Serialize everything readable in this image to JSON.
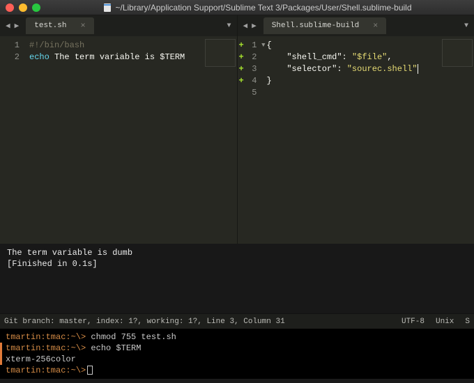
{
  "title": "~/Library/Application Support/Sublime Text 3/Packages/User/Shell.sublime-build",
  "left_tab": "test.sh",
  "right_tab": "Shell.sublime-build",
  "left_code": {
    "l1_shebang": "#!/bin/bash",
    "l2_kw": "echo",
    "l2_txt": " The term variable is $TERM"
  },
  "right_code": {
    "brace_open": "{",
    "k1": "\"shell_cmd\"",
    "v1": "\"$file\"",
    "k2": "\"selector\"",
    "v2": "\"sourec.shell\"",
    "brace_close": "}"
  },
  "build": {
    "line1": "The term variable is dumb",
    "line2": "[Finished in 0.1s]"
  },
  "status": {
    "left": "Git branch: master, index: 1?, working: 1?, Line 3, Column 31",
    "enc": "UTF-8",
    "endings": "Unix",
    "syntax_initial": "S"
  },
  "terminal": {
    "prompt": "tmartin:tmac:~\\>",
    "cmd1": "chmod 755 test.sh",
    "cmd2": "echo $TERM",
    "out1": "xterm-256color"
  },
  "gutnums": {
    "n1": "1",
    "n2": "2",
    "n3": "3",
    "n4": "4",
    "n5": "5"
  }
}
